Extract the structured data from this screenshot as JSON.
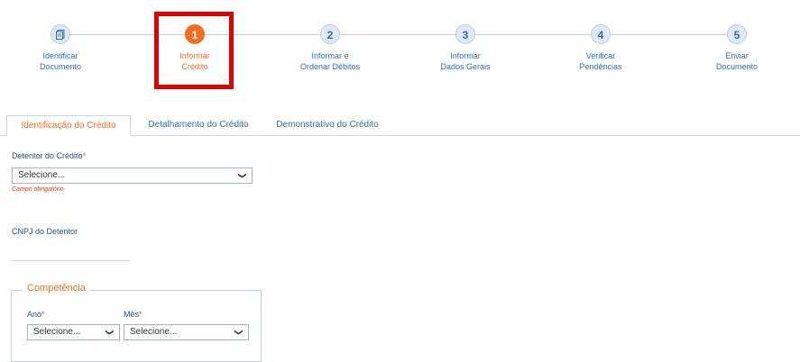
{
  "steps": [
    {
      "number": "",
      "icon": "document-icon",
      "label_line1": "Identificar",
      "label_line2": "Documento",
      "active": false
    },
    {
      "number": "1",
      "label_line1": "Informar",
      "label_line2": "Crédito",
      "active": true
    },
    {
      "number": "2",
      "label_line1": "Informar e",
      "label_line2": "Ordenar Débitos",
      "active": false
    },
    {
      "number": "3",
      "label_line1": "Informar",
      "label_line2": "Dados Gerais",
      "active": false
    },
    {
      "number": "4",
      "label_line1": "Verificar",
      "label_line2": "Pendências",
      "active": false
    },
    {
      "number": "5",
      "label_line1": "Enviar",
      "label_line2": "Documento",
      "active": false
    }
  ],
  "tabs": [
    {
      "label": "Identificação do Crédito",
      "active": true
    },
    {
      "label": "Detalhamento do Crédito",
      "active": false
    },
    {
      "label": "Demonstrativo do Crédito",
      "active": false
    }
  ],
  "form": {
    "detentor_label": "Detentor do Crédito",
    "required_mark": "*",
    "detentor_value": "Selecione...",
    "detentor_error": "Campo obrigatório",
    "cnpj_label": "CNPJ do Detentor",
    "cnpj_value": "",
    "competencia_legend": "Competência",
    "ano_label": "Ano",
    "ano_value": "Selecione...",
    "mes_label": "Mês",
    "mes_value": "Selecione..."
  },
  "colors": {
    "accent": "#f26f21",
    "primary": "#2f6fae",
    "highlight": "#e00000"
  }
}
